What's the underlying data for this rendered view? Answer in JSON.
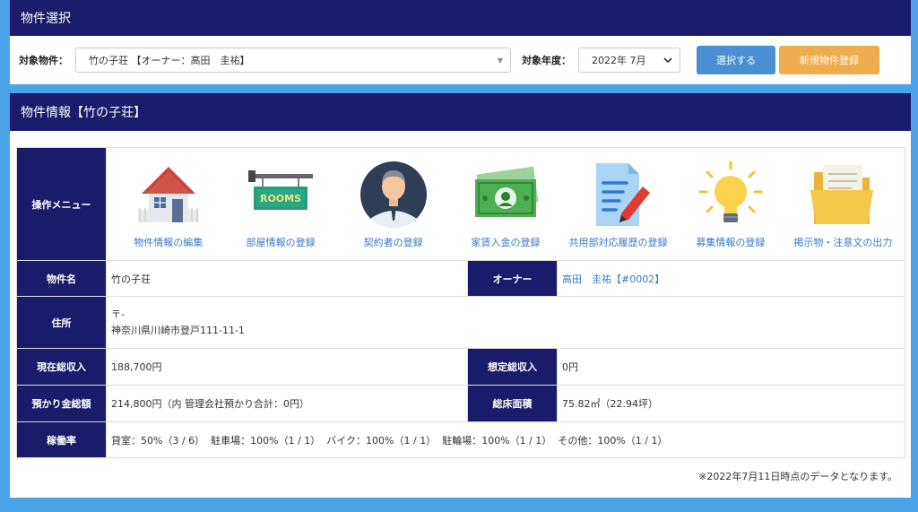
{
  "select_panel": {
    "title": "物件選択",
    "property_label": "対象物件：",
    "property_value": "竹の子荘 【オーナー：高田　圭祐】",
    "year_label": "対象年度：",
    "year_value": "2022年 7月",
    "select_button": "選択する",
    "new_button": "新規物件登録"
  },
  "info_panel": {
    "title": "物件情報【竹の子荘】",
    "menu_header": "操作メニュー",
    "menu": [
      {
        "icon": "house-icon",
        "label": "物件情報の編集"
      },
      {
        "icon": "rooms-sign-icon",
        "label": "部屋情報の登録"
      },
      {
        "icon": "person-icon",
        "label": "契約者の登録"
      },
      {
        "icon": "money-icon",
        "label": "家賃入金の登録"
      },
      {
        "icon": "document-edit-icon",
        "label": "共用部対応履歴の登録"
      },
      {
        "icon": "lightbulb-icon",
        "label": "募集情報の登録"
      },
      {
        "icon": "folder-icon",
        "label": "掲示物・注意文の出力"
      }
    ],
    "rooms_sign_text": "ROOMS",
    "rows": {
      "name_label": "物件名",
      "name_value": "竹の子荘",
      "owner_label": "オーナー",
      "owner_value": "高田　圭祐【#0002】",
      "address_label": "住所",
      "address_zip": "〒-",
      "address_value": "神奈川県川崎市登戸111-11-1",
      "income_label": "現在総収入",
      "income_value": "188,700円",
      "expected_label": "想定総収入",
      "expected_value": "0円",
      "deposit_label": "預かり金総額",
      "deposit_value": "214,800円（内 管理会社預かり合計：0円）",
      "floor_label": "総床面積",
      "floor_value": "75.82㎡（22.94坪）",
      "occupancy_label": "稼働率",
      "occupancy_value": "貸室：50%（3 / 6）  駐車場：100%（1 / 1）  バイク：100%（1 / 1）  駐輪場：100%（1 / 1）  その他：100%（1 / 1）"
    },
    "note": "※2022年7月11日時点のデータとなります。"
  }
}
